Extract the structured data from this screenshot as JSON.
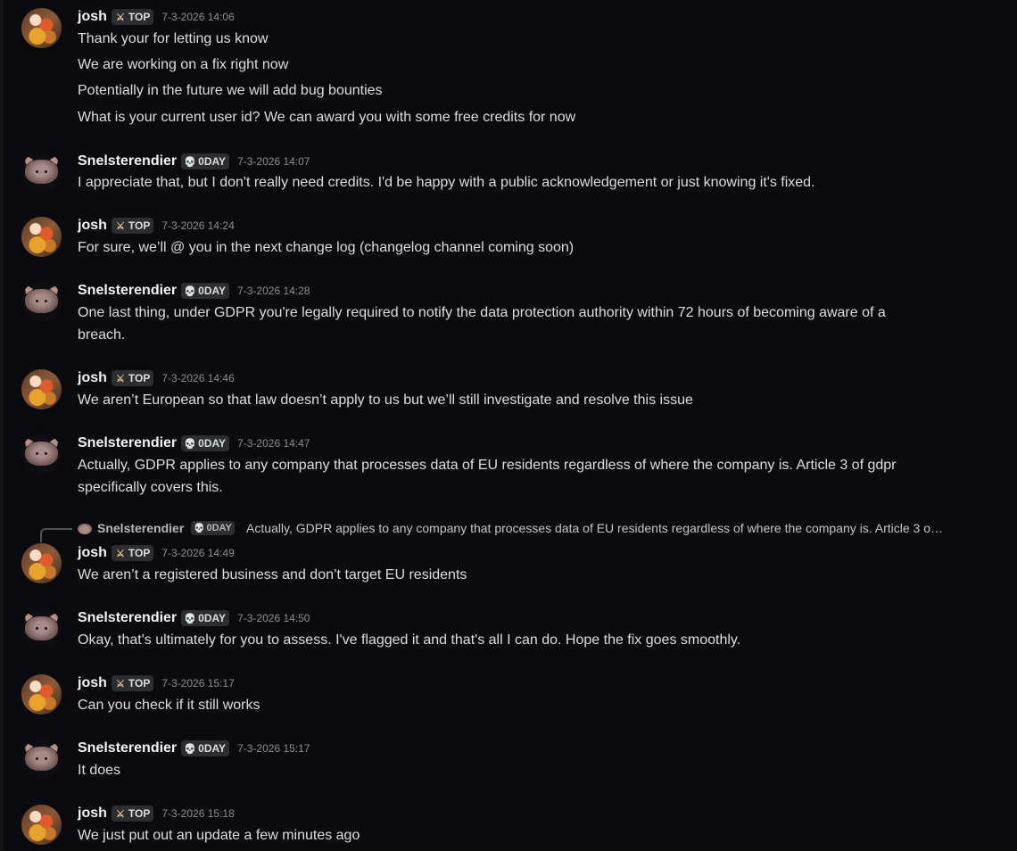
{
  "users": {
    "josh": {
      "name": "josh",
      "tag_label": "TOP",
      "tag_icon": "sword-icon"
    },
    "snel": {
      "name": "Snelsterendier",
      "tag_label": "0DAY",
      "tag_icon": "skull-icon"
    }
  },
  "colors": {
    "background": "#0b0b0f",
    "username": "#f2f3f5",
    "message_text": "#dbdee1",
    "timestamp": "#8b8e95",
    "tag_background": "#2b2d31",
    "skull_accent": "#f06bb5"
  },
  "messages": [
    {
      "author": "josh",
      "timestamp": "7-3-2026 14:06",
      "lines": [
        "Thank your for letting us know",
        "We are working on a fix right now",
        "Potentially in the future we will add bug bounties",
        "What is your current user id? We can award you with some free credits for now"
      ]
    },
    {
      "author": "Snelsterendier",
      "timestamp": "7-3-2026 14:07",
      "lines": [
        "I appreciate that, but I don't really need credits. I'd be happy with a public acknowledgement or just knowing it's fixed."
      ]
    },
    {
      "author": "josh",
      "timestamp": "7-3-2026 14:24",
      "lines": [
        "For sure, we’ll @ you in the next change log (changelog channel coming soon)"
      ]
    },
    {
      "author": "Snelsterendier",
      "timestamp": "7-3-2026 14:28",
      "lines": [
        "One last thing, under GDPR you're legally required to notify the data protection authority within 72 hours of becoming aware of a",
        "breach."
      ]
    },
    {
      "author": "josh",
      "timestamp": "7-3-2026 14:46",
      "lines": [
        "We aren’t European so that law doesn’t apply to us but we’ll still investigate and resolve this issue"
      ]
    },
    {
      "author": "Snelsterendier",
      "timestamp": "7-3-2026 14:47",
      "lines": [
        "Actually, GDPR applies to any company that processes data of EU residents regardless of where the company is. Article 3 of gdpr",
        "specifically covers this."
      ]
    },
    {
      "author": "josh",
      "timestamp": "7-3-2026 14:49",
      "lines": [
        "We aren’t a registered business and don’t target EU residents"
      ]
    },
    {
      "author": "Snelsterendier",
      "timestamp": "7-3-2026 14:50",
      "lines": [
        "Okay, that's ultimately for you to assess. I've flagged it and that's all I can do. Hope the fix goes smoothly."
      ]
    },
    {
      "author": "josh",
      "timestamp": "7-3-2026 15:17",
      "lines": [
        "Can you check if it still works"
      ]
    },
    {
      "author": "Snelsterendier",
      "timestamp": "7-3-2026 15:17",
      "lines": [
        "It does"
      ]
    },
    {
      "author": "josh",
      "timestamp": "7-3-2026 15:18",
      "lines": [
        "We just put out an update a few minutes ago"
      ]
    }
  ],
  "reply": {
    "author": "Snelsterendier",
    "tag_label": "0DAY",
    "preview": "Actually, GDPR applies to any company that processes data of EU residents regardless of where the company is. Article 3 o…"
  }
}
